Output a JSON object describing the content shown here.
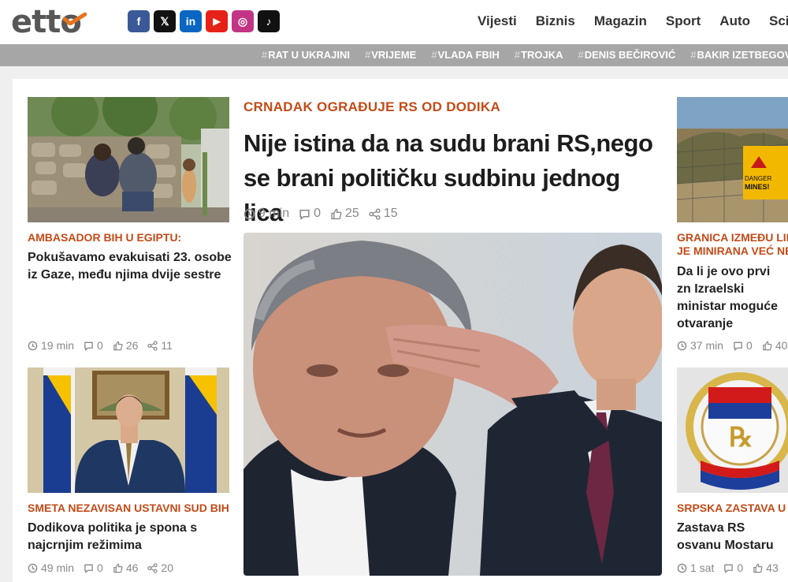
{
  "site": {
    "logo": "etto"
  },
  "social": [
    {
      "name": "facebook",
      "glyph": "f",
      "color": "#3b5998"
    },
    {
      "name": "x",
      "glyph": "𝕏",
      "color": "#111111"
    },
    {
      "name": "linkedin",
      "glyph": "in",
      "color": "#0a66c2"
    },
    {
      "name": "youtube",
      "glyph": "▶",
      "color": "#e62117"
    },
    {
      "name": "instagram",
      "glyph": "◎",
      "color": "#c13584"
    },
    {
      "name": "tiktok",
      "glyph": "♪",
      "color": "#111111"
    }
  ],
  "nav": [
    "Vijesti",
    "Biznis",
    "Magazin",
    "Sport",
    "Auto",
    "Sci"
  ],
  "tags": [
    "RAT U UKRAJINI",
    "VRIJEME",
    "VLADA FBIH",
    "TROJKA",
    "DENIS BEČIROVIĆ",
    "BAKIR IZETBEGOVIĆ"
  ],
  "main": {
    "kicker": "CRNADAK OGRAĐUJE RS OD DODIKA",
    "title": "Nije istina da na sudu brani RS,nego se brani političku sudbinu jednog lica",
    "time": "9 min",
    "comments": "0",
    "likes": "25",
    "shares": "15"
  },
  "left": [
    {
      "kicker": "AMBASADOR BIH U EGIPTU:",
      "title": "Pokušavamo evakuisati 23. osobe iz Gaze, među njima dvije sestre",
      "time": "19 min",
      "comments": "0",
      "likes": "26",
      "shares": "11"
    },
    {
      "kicker": "SMETA NEZAVISAN USTAVNI SUD BIH",
      "title": "Dodikova politika je spona s najcrnjim režimima",
      "time": "49 min",
      "comments": "0",
      "likes": "46",
      "shares": "20"
    }
  ],
  "right": [
    {
      "kicker1": "GRANICA IZMEĐU LIB",
      "kicker2": "JE MINIRANA VEĆ NE",
      "title": "Da li je ovo prvi zn Izraelski ministar moguće otvaranje Hezbolahom",
      "time": "37 min",
      "comments": "0",
      "likes": "40",
      "sign_top": "DANGER",
      "sign_bottom": "MINES!"
    },
    {
      "kicker": "SRPSKA ZASTAVA U M",
      "title": "Zastava RS osvanu Mostaru",
      "time": "1 sat",
      "comments": "0",
      "likes": "43"
    }
  ],
  "colors": {
    "accent": "#c34a17",
    "tagbar": "#a6a6a6",
    "logo_check": "#e8731c"
  }
}
